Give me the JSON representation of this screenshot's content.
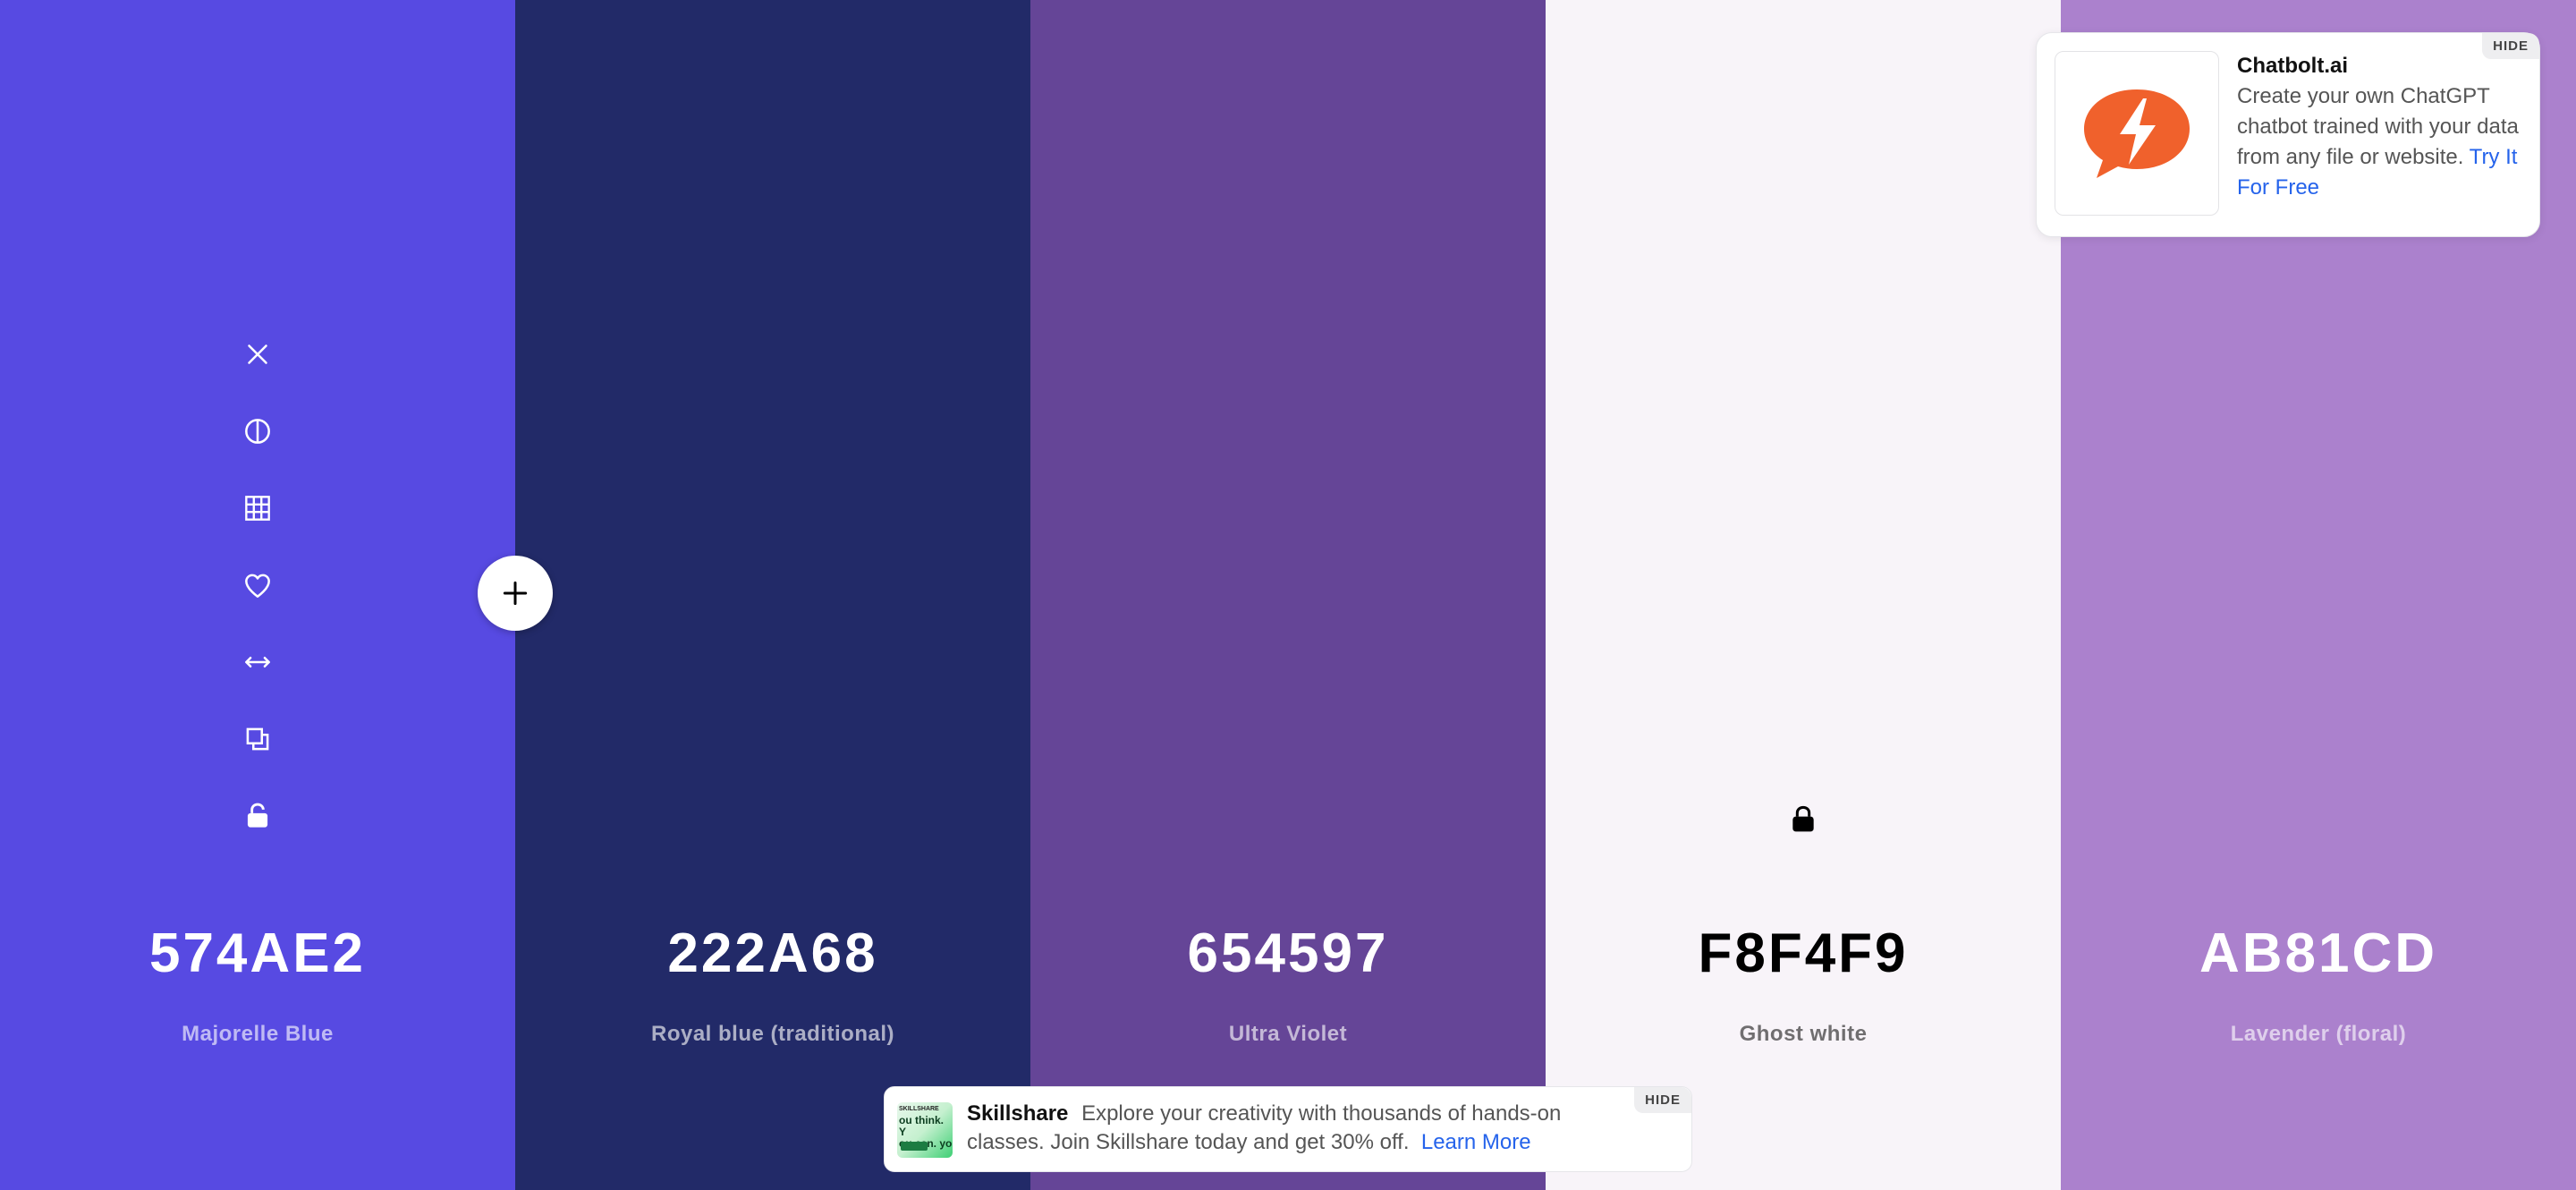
{
  "swatches": [
    {
      "hex": "574AE2",
      "name": "Majorelle Blue",
      "color": "#574AE2"
    },
    {
      "hex": "222A68",
      "name": "Royal blue (traditional)",
      "color": "#222A68"
    },
    {
      "hex": "654597",
      "name": "Ultra Violet",
      "color": "#654597"
    },
    {
      "hex": "F8F4F9",
      "name": "Ghost white",
      "color": "#F8F4F9"
    },
    {
      "hex": "AB81CD",
      "name": "Lavender (floral)",
      "color": "#AB81CD"
    }
  ],
  "toolbar_icons": [
    "close-icon",
    "contrast-icon",
    "grid-icon",
    "heart-icon",
    "drag-arrows-icon",
    "copy-icon",
    "unlock-icon"
  ],
  "ad_top": {
    "title": "Chatbolt.ai",
    "body": "Create your own ChatGPT chatbot trained with your data from any file or website.",
    "link": "Try It For Free",
    "hide": "HIDE",
    "brand_color": "#F0612C"
  },
  "ad_bottom": {
    "title": "Skillshare",
    "body": "Explore your creativity with thousands of hands-on classes. Join Skillshare today and get 30% off.",
    "link": "Learn More",
    "hide": "HIDE",
    "thumb_lines": [
      "SKILLSHARE",
      "ou think. Y",
      "ou can. yo"
    ]
  },
  "link_color": "#2563EB"
}
